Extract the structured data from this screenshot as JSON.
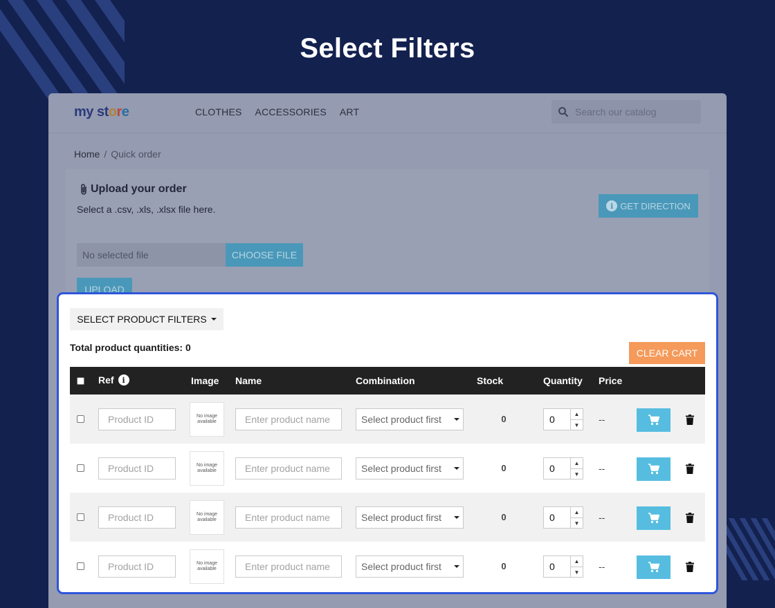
{
  "hero": {
    "title": "Select Filters"
  },
  "store": {
    "logo": {
      "my": "my",
      "s": "s",
      "t": "t",
      "o": "o",
      "r": "r",
      "e": "e"
    },
    "nav": [
      "CLOTHES",
      "ACCESSORIES",
      "ART"
    ],
    "search_placeholder": "Search our catalog",
    "breadcrumb": {
      "home": "Home",
      "separator": "/",
      "current": "Quick order"
    }
  },
  "upload": {
    "title": "Upload your order",
    "subtitle": "Select a .csv, .xls, .xlsx file here.",
    "get_direction": "GET DIRECTION",
    "no_file": "No selected file",
    "choose_file": "CHOOSE FILE",
    "upload_label": "UPLOAD"
  },
  "panel": {
    "filters_label": "SELECT PRODUCT FILTERS",
    "total_label": "Total product quantities: 0",
    "clear_cart": "CLEAR CART",
    "columns": {
      "ref": "Ref",
      "image": "Image",
      "name": "Name",
      "combination": "Combination",
      "stock": "Stock",
      "quantity": "Quantity",
      "price": "Price"
    },
    "rows": [
      {
        "product_id_placeholder": "Product ID",
        "image_text": "No image available",
        "name_placeholder": "Enter product name",
        "combination": "Select product first",
        "stock": "0",
        "quantity": "0",
        "price": "--"
      },
      {
        "product_id_placeholder": "Product ID",
        "image_text": "No image available",
        "name_placeholder": "Enter product name",
        "combination": "Select product first",
        "stock": "0",
        "quantity": "0",
        "price": "--"
      },
      {
        "product_id_placeholder": "Product ID",
        "image_text": "No image available",
        "name_placeholder": "Enter product name",
        "combination": "Select product first",
        "stock": "0",
        "quantity": "0",
        "price": "--"
      },
      {
        "product_id_placeholder": "Product ID",
        "image_text": "No image available",
        "name_placeholder": "Enter product name",
        "combination": "Select product first",
        "stock": "0",
        "quantity": "0",
        "price": "--"
      }
    ]
  },
  "colors": {
    "background": "#13214f",
    "panel_border": "#2d55dc",
    "cart_button": "#56bde0",
    "clear_cart": "#f59a5a",
    "table_header": "#222222"
  },
  "icons": {
    "search": "search-icon",
    "paperclip": "paperclip-icon",
    "info": "info-icon",
    "cart": "cart-icon",
    "trash": "trash-icon",
    "caret": "caret-down-icon"
  }
}
